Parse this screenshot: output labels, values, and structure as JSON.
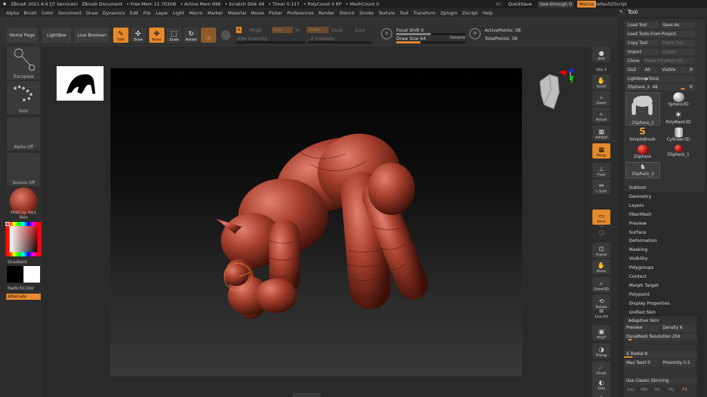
{
  "titlebar": {
    "app": "ZBrush 2021.6.6 [JT Services]",
    "doc": "ZBrush Document",
    "free_mem": "• Free Mem 11.703GB",
    "active_mem": "• Active Mem 696",
    "scratch": "• Scratch Disk 49",
    "timer": "• Timer 0.117",
    "polycount": "• PolyCount 0 KP",
    "meshcount": "• MeshCount 0",
    "ac": "AC",
    "quicksave": "QuickSave",
    "seethrough": "See-through 0",
    "menus": "Menus",
    "defaultzscript": "DefaultZScript"
  },
  "menubar": [
    "Alpha",
    "Brush",
    "Color",
    "Document",
    "Draw",
    "Dynamics",
    "Edit",
    "File",
    "Layer",
    "Light",
    "Macro",
    "Marker",
    "Material",
    "Movie",
    "Picker",
    "Preferences",
    "Render",
    "Stencil",
    "Stroke",
    "Texture",
    "Tool",
    "Transform",
    "Zplugin",
    "Zscript",
    "Help"
  ],
  "toolbar": {
    "home": "Home Page",
    "lightbox": "LightBox",
    "liveboolean": "Live Boolean",
    "edit": "Edit",
    "draw": "Draw",
    "move": "Move",
    "scale": "Scale",
    "rotate": "Rotate",
    "a_chip": "A",
    "mrgb": "Mrgb",
    "rgb": "Rgb",
    "m": "M",
    "zadd": "Zadd",
    "zsub": "Zsub",
    "zcut": "Zcut",
    "rgb_intensity": "Rgb Intensity",
    "z_intensity": "Z Intensity",
    "focal_shift": "Focal Shift 0",
    "draw_size": "Draw Size 64",
    "dynamic": "Dynamic",
    "active_points": "ActivePoints: 38",
    "total_points": "TotalPoints: 38",
    "draw_size_fraction": 0.35,
    "focal_fraction": 0.5
  },
  "lefttray": {
    "transpose": "Transpose",
    "dots": "Dots",
    "alpha": "Alpha Off",
    "texture": "Texture Off",
    "matcap": "MatCap Red Wax",
    "gradient": "Gradient",
    "switchcolor": "SwitchColor",
    "alternate": "Alternate"
  },
  "righttray": [
    "BPR",
    "SPix 3",
    "Scroll",
    "Zoom",
    "Actual",
    "AAHalf",
    "Persp",
    "Floor",
    "L.Sym",
    "",
    "Qxyz",
    "",
    "",
    "Frame",
    "Move",
    "Zoom3D",
    "Rotate",
    "Line Fill",
    "PolyF",
    "Transp",
    "Ghost",
    "Solo",
    "Xpose"
  ],
  "toolpanel": {
    "title": "Tool",
    "load": "Load Tool",
    "saveas": "Save As",
    "loadproject": "Load Tools From Project",
    "copy": "Copy Tool",
    "paste": "Paste Tool",
    "import": "Import",
    "export": "Export",
    "clone": "Clone",
    "makepoly": "Make PolyMesh3D",
    "goz": "GoZ",
    "all": "All",
    "visible": "Visible",
    "r": "R",
    "lightbox_tools": "Lightbox▶Tools",
    "current": "ZSphere_2. 48",
    "r2": "R",
    "tools": [
      "ZSphere_2",
      "Sphere3D",
      "",
      "PolyMesh3D",
      "SimpleBrush",
      "Cylinder3D",
      "ZSphere",
      "ZSphere_1",
      "ZSphere_2"
    ],
    "subpalettes": [
      "Subtool",
      "Geometry",
      "Layers",
      "FiberMesh",
      "Preview",
      "Surface",
      "Deformation",
      "Masking",
      "Visibility",
      "Polygroups",
      "Contact",
      "Morph Target",
      "Polypaint",
      "Display Properties",
      "Unified Skin"
    ],
    "adaptive": "Adaptive Skin",
    "preview": "Preview",
    "density": "Density 6",
    "dynamesh": "DynaMesh Resolution 256",
    "gradial": "G Radial 8",
    "maxtwist": "Max Twist 0",
    "proximity": "Proximity 0.5",
    "classic": "Use Classic Skinning",
    "bottom": [
      "Ires",
      "Mbr",
      "Mc",
      "Mp",
      "Pd"
    ],
    "accent": "#e88a2c"
  }
}
